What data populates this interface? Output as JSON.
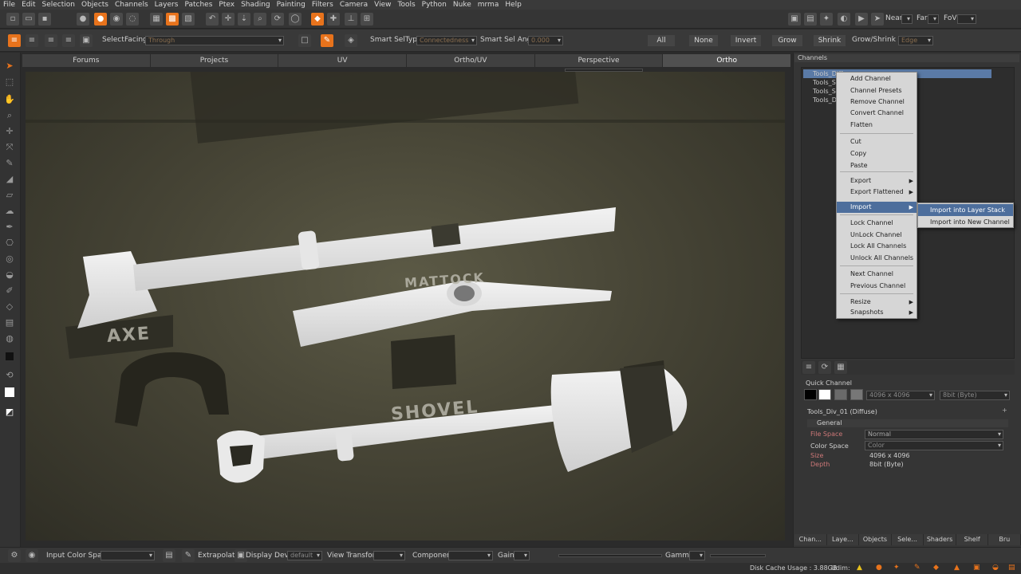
{
  "menubar": [
    "File",
    "Edit",
    "Selection",
    "Objects",
    "Channels",
    "Layers",
    "Patches",
    "Ptex",
    "Shading",
    "Painting",
    "Filters",
    "Camera",
    "View",
    "Tools",
    "Python",
    "Nuke",
    "mrma",
    "Help"
  ],
  "toolbar_top": {
    "near_label": "Near",
    "far_label": "Far",
    "fov_label": "FoV"
  },
  "seltoolbar": {
    "select_label": "Select",
    "facing_label": "Facing",
    "facing_value": "Through",
    "smart_seltype_label": "Smart SelType:",
    "smart_seltype_value": "Connectedness",
    "smart_sel_angle_label": "Smart Sel Angle",
    "smart_sel_angle_value": "0.000",
    "all": "All",
    "none": "None",
    "invert": "Invert",
    "grow": "Grow",
    "shrink": "Shrink",
    "grow_shrink_label": "Grow/Shrink by",
    "grow_shrink_value": "Edge"
  },
  "viewport_tabs": [
    "Forums",
    "Projects",
    "UV",
    "Ortho/UV",
    "Perspective",
    "Ortho"
  ],
  "viewport": {
    "stencils": {
      "axe": "AXE",
      "mattock": "MATTOCK",
      "shovel": "SHOVEL"
    }
  },
  "channels_panel": {
    "title": "Channels",
    "rows": [
      "Tools_Diff",
      "Tools_Sp",
      "Tools_Sc",
      "Tools_Dif"
    ]
  },
  "context_menu": {
    "items": [
      {
        "label": "Add Channel"
      },
      {
        "label": "Channel Presets"
      },
      {
        "label": "Remove Channel"
      },
      {
        "label": "Convert Channel"
      },
      {
        "label": "Flatten"
      },
      {
        "label": "Cut"
      },
      {
        "label": "Copy"
      },
      {
        "label": "Paste"
      },
      {
        "label": "Export"
      },
      {
        "label": "Export Flattened"
      },
      {
        "label": "Import"
      },
      {
        "label": "Lock Channel"
      },
      {
        "label": "UnLock Channel"
      },
      {
        "label": "Lock All Channels"
      },
      {
        "label": "Unlock All Channels"
      },
      {
        "label": "Next Channel"
      },
      {
        "label": "Previous Channel"
      },
      {
        "label": "Resize"
      },
      {
        "label": "Snapshots"
      }
    ],
    "submenu": [
      {
        "label": "Import into Layer Stack"
      },
      {
        "label": "Import into New Channel"
      }
    ]
  },
  "quick_channel": {
    "title": "Quick Channel",
    "size_value": "4096 x 4096",
    "depth_value": "8bit (Byte)"
  },
  "properties": {
    "channel_name": "Tools_Div_01 (Diffuse)",
    "section": "General",
    "file_space_label": "File Space",
    "file_space_value": "Normal",
    "color_space_label": "Color Space",
    "color_space_value": "Color",
    "size_label": "Size",
    "size_value": "4096 x 4096",
    "depth_label": "Depth",
    "depth_value": "8bit (Byte)"
  },
  "bottom_tabs": [
    "Chan...",
    "Laye...",
    "Objects",
    "Sele...",
    "Shaders",
    "Shelf",
    "Bru"
  ],
  "display_bar": {
    "input_color_space": "Input Color Space",
    "extrapolate": "Extrapolate",
    "display_device": "Display Device",
    "display_device_value": "default",
    "view_transform": "View Transform",
    "component": "Component",
    "gain": "Gain",
    "gamma": "Gamma"
  },
  "status": {
    "disk_cache": "Disk Cache Usage : 3.88GB",
    "udim": "Udim:"
  }
}
